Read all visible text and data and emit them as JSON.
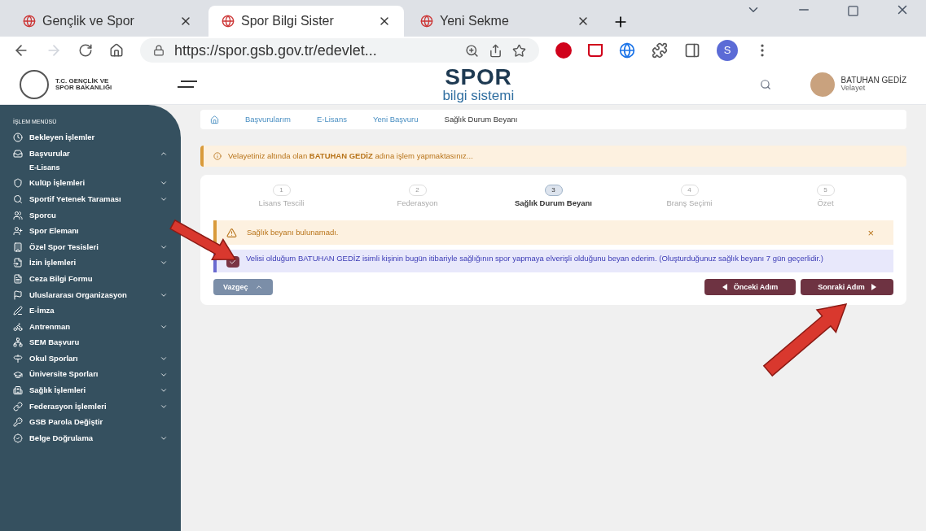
{
  "browser": {
    "tabs": [
      {
        "title": "Gençlik ve Spor",
        "selected": false
      },
      {
        "title": "Spor Bilgi Sister",
        "selected": true
      },
      {
        "title": "Yeni Sekme",
        "selected": false
      }
    ],
    "url": "https://spor.gsb.gov.tr/edevlet...",
    "profile_initial": "S"
  },
  "header": {
    "ministry_line1": "T.C. GENÇLİK VE",
    "ministry_line2": "SPOR BAKANLIĞI",
    "logo_top": "SPOR",
    "logo_bottom": "bilgi sistemi",
    "user_name": "BATUHAN GEDİZ",
    "user_role": "Velayet"
  },
  "sidebar": {
    "title": "İŞLEM MENÜSÜ",
    "items": [
      {
        "label": "Bekleyen İşlemler",
        "kind": "link"
      },
      {
        "label": "Başvurular",
        "kind": "group",
        "expanded": true,
        "children": [
          {
            "label": "E-Lisans"
          }
        ]
      },
      {
        "label": "Kulüp İşlemleri",
        "kind": "group",
        "expanded": false
      },
      {
        "label": "Sportif Yetenek Taraması",
        "kind": "group",
        "expanded": false
      },
      {
        "label": "Sporcu",
        "kind": "link"
      },
      {
        "label": "Spor Elemanı",
        "kind": "link"
      },
      {
        "label": "Özel Spor Tesisleri",
        "kind": "group",
        "expanded": false
      },
      {
        "label": "İzin İşlemleri",
        "kind": "group",
        "expanded": false
      },
      {
        "label": "Ceza Bilgi Formu",
        "kind": "link"
      },
      {
        "label": "Uluslararası Organizasyon",
        "kind": "group",
        "expanded": false
      },
      {
        "label": "E-İmza",
        "kind": "link"
      },
      {
        "label": "Antrenman",
        "kind": "group",
        "expanded": false
      },
      {
        "label": "SEM Başvuru",
        "kind": "link"
      },
      {
        "label": "Okul Sporları",
        "kind": "group",
        "expanded": false
      },
      {
        "label": "Üniversite Sporları",
        "kind": "group",
        "expanded": false
      },
      {
        "label": "Sağlık İşlemleri",
        "kind": "group",
        "expanded": false
      },
      {
        "label": "Federasyon İşlemleri",
        "kind": "group",
        "expanded": false
      },
      {
        "label": "GSB Parola Değiştir",
        "kind": "link"
      },
      {
        "label": "Belge Doğrulama",
        "kind": "group",
        "expanded": false
      }
    ]
  },
  "breadcrumb": [
    "Başvurularım",
    "E-Lisans",
    "Yeni Başvuru",
    "Sağlık Durum Beyanı"
  ],
  "guardian_notice": "Velayetiniz altında olan **BATUHAN GEDİZ** adına işlem yapmaktasınız...",
  "steps": [
    {
      "number": "1",
      "label": "Lisans Tescili",
      "selected": false
    },
    {
      "number": "2",
      "label": "Federasyon",
      "selected": false
    },
    {
      "number": "3",
      "label": "Sağlık Durum Beyanı",
      "selected": true
    },
    {
      "number": "4",
      "label": "Branş Seçimi",
      "selected": false
    },
    {
      "number": "5",
      "label": "Özet",
      "selected": false
    }
  ],
  "warning": {
    "text": "Sağlık beyanı bulunamadı.",
    "close": "×"
  },
  "declaration": {
    "checked": true,
    "text": "Velisi olduğum BATUHAN GEDİZ isimli kişinin bugün itibariyle sağlığının spor yapmaya elverişli olduğunu beyan ederim. (Oluşturduğunuz sağlık beyanı 7 gün geçerlidir.)"
  },
  "buttons": {
    "cancel": "Vazgeç",
    "previous": "Önceki Adım",
    "next": "Sonraki Adım"
  }
}
